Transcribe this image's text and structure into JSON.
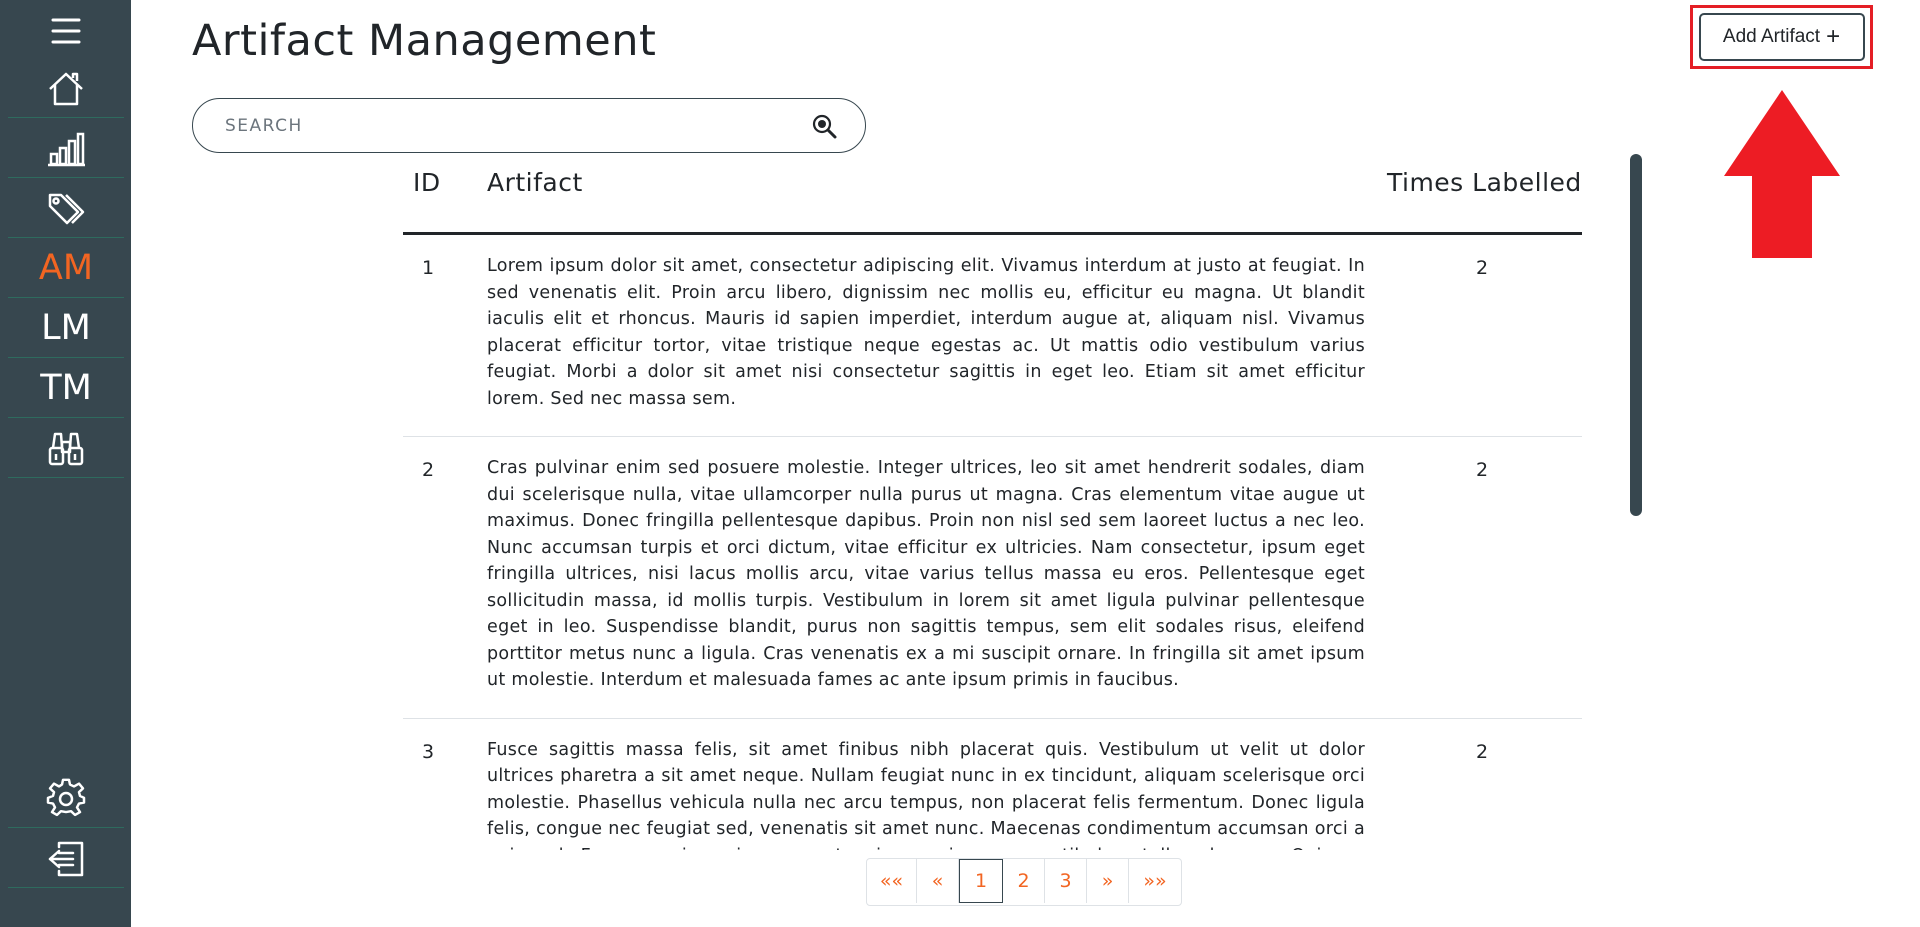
{
  "sidebar": {
    "items": [
      {
        "name": "menu-icon"
      },
      {
        "name": "home-icon"
      },
      {
        "name": "bar-chart-icon"
      },
      {
        "name": "tags-icon"
      },
      {
        "label": "AM",
        "active": true
      },
      {
        "label": "LM"
      },
      {
        "label": "TM"
      },
      {
        "name": "binoculars-icon"
      },
      {
        "name": "gear-icon"
      },
      {
        "name": "logout-icon"
      }
    ]
  },
  "header": {
    "title": "Artifact Management",
    "add_button_label": "Add Artifact",
    "add_button_icon": "+"
  },
  "search": {
    "placeholder": "SEARCH"
  },
  "table": {
    "columns": {
      "id": "ID",
      "artifact": "Artifact",
      "times_labelled": "Times Labelled"
    },
    "rows": [
      {
        "id": "1",
        "artifact": "Lorem ipsum dolor sit amet, consectetur adipiscing elit. Vivamus interdum at justo at feugiat. In sed venenatis elit. Proin arcu libero, dignissim nec mollis eu, efficitur eu magna. Ut blandit iaculis elit et rhoncus. Mauris id sapien imperdiet, interdum augue at, aliquam nisl. Vivamus placerat efficitur tortor, vitae tristique neque egestas ac. Ut mattis odio vestibulum varius feugiat. Morbi a dolor sit amet nisi consectetur sagittis in eget leo. Etiam sit amet efficitur lorem. Sed nec massa sem.",
        "times_labelled": "2"
      },
      {
        "id": "2",
        "artifact": "Cras pulvinar enim sed posuere molestie. Integer ultrices, leo sit amet hendrerit sodales, diam dui scelerisque nulla, vitae ullamcorper nulla purus ut magna. Cras elementum vitae augue ut maximus. Donec fringilla pellentesque dapibus. Proin non nisl sed sem laoreet luctus a nec leo. Nunc accumsan turpis et orci dictum, vitae efficitur ex ultricies. Nam consectetur, ipsum eget fringilla ultrices, nisi lacus mollis arcu, vitae varius tellus massa eu eros. Pellentesque eget sollicitudin massa, id mollis turpis. Vestibulum in lorem sit amet ligula pulvinar pellentesque eget in leo. Suspendisse blandit, purus non sagittis tempus, sem elit sodales risus, eleifend porttitor metus nunc a ligula. Cras venenatis ex a mi suscipit ornare. In fringilla sit amet ipsum ut molestie. Interdum et malesuada fames ac ante ipsum primis in faucibus.",
        "times_labelled": "2"
      },
      {
        "id": "3",
        "artifact": "Fusce sagittis massa felis, sit amet finibus nibh placerat quis. Vestibulum ut velit ut dolor ultrices pharetra a sit amet neque. Nullam feugiat nunc in ex tincidunt, aliquam scelerisque orci molestie. Phasellus vehicula nulla nec arcu tempus, non placerat felis fermentum. Donec ligula felis, congue nec feugiat sed, venenatis sit amet nunc. Maecenas condimentum accumsan orci a euismod. Fusce maximus ipsum eget enim maximus, a vestibulum tellus rhoncus. Quisque laoreet",
        "times_labelled": "2"
      }
    ]
  },
  "pagination": {
    "first": "««",
    "prev": "«",
    "pages": [
      "1",
      "2",
      "3"
    ],
    "current": "1",
    "next": "»",
    "last": "»»"
  },
  "colors": {
    "sidebar_bg": "#37474f",
    "accent": "#f26522",
    "highlight_red": "#e41e25"
  }
}
